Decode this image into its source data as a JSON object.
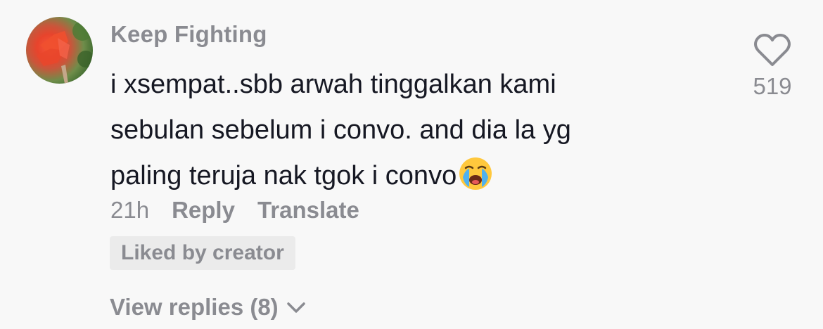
{
  "comment": {
    "username": "Keep Fighting",
    "text_lines": [
      "i xsempat..sbb arwah tinggalkan kami",
      "sebulan sebelum i convo. and dia la yg",
      "paling teruja nak tgok i convo"
    ],
    "emoji": "loudly-crying-face-emoji",
    "time": "21h",
    "reply_label": "Reply",
    "translate_label": "Translate",
    "liked_badge": "Liked by creator",
    "view_replies_label": "View replies (8)",
    "like_count": "519"
  },
  "colors": {
    "background": "#f8f8f8",
    "primary_text": "#161823",
    "secondary_text": "#8a8b91",
    "badge_bg": "#ebebeb"
  }
}
